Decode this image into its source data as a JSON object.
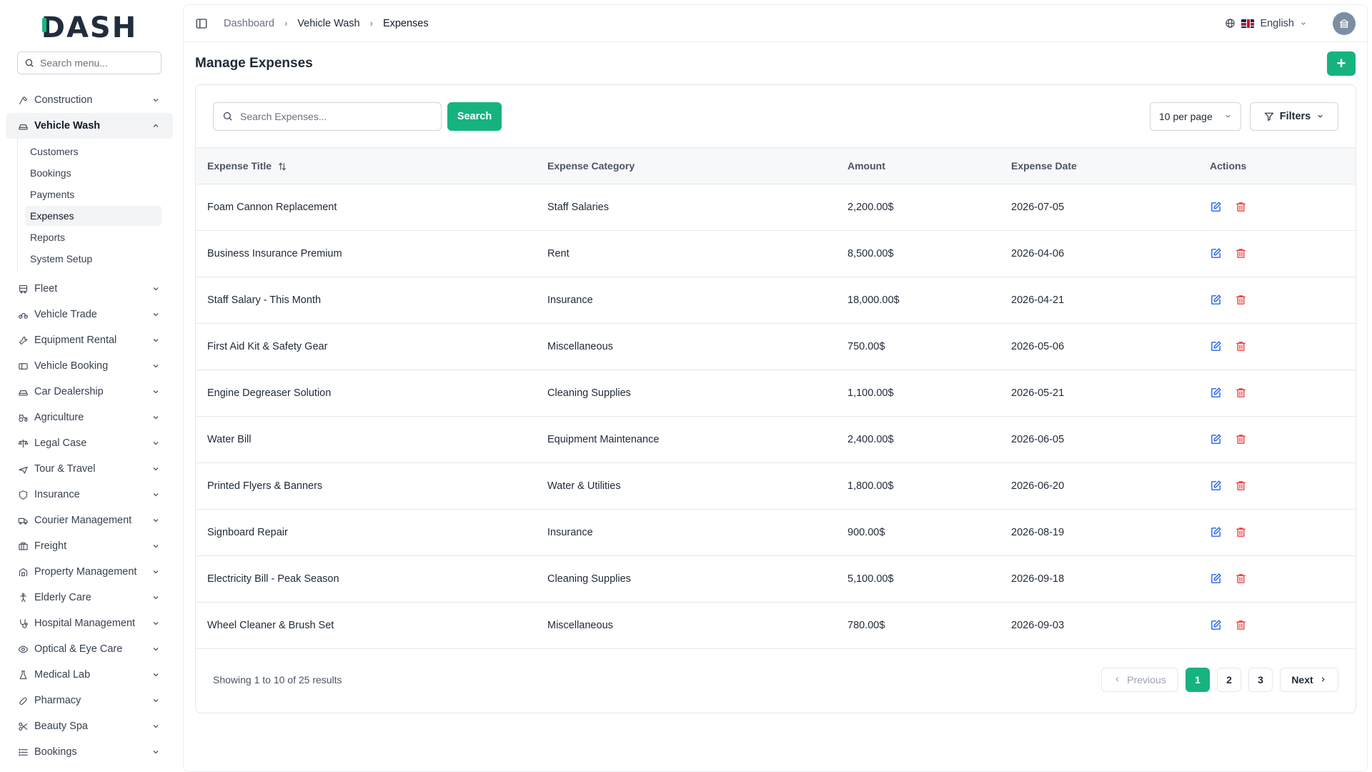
{
  "sidebar": {
    "logo": "DASH",
    "search_placeholder": "Search menu...",
    "items": [
      {
        "label": "Construction",
        "icon": "hammer-icon"
      },
      {
        "label": "Vehicle Wash",
        "icon": "car-icon",
        "expanded": true,
        "children": [
          {
            "label": "Customers"
          },
          {
            "label": "Bookings"
          },
          {
            "label": "Payments"
          },
          {
            "label": "Expenses",
            "active": true
          },
          {
            "label": "Reports"
          },
          {
            "label": "System Setup"
          }
        ]
      },
      {
        "label": "Fleet",
        "icon": "bus-icon"
      },
      {
        "label": "Vehicle Trade",
        "icon": "bike-icon"
      },
      {
        "label": "Equipment Rental",
        "icon": "wrench-icon"
      },
      {
        "label": "Vehicle Booking",
        "icon": "ticket-icon"
      },
      {
        "label": "Car Dealership",
        "icon": "car-icon"
      },
      {
        "label": "Agriculture",
        "icon": "tractor-icon"
      },
      {
        "label": "Legal Case",
        "icon": "scale-icon"
      },
      {
        "label": "Tour & Travel",
        "icon": "plane-icon"
      },
      {
        "label": "Insurance",
        "icon": "shield-icon"
      },
      {
        "label": "Courier Management",
        "icon": "truck-icon"
      },
      {
        "label": "Freight",
        "icon": "container-icon"
      },
      {
        "label": "Property Management",
        "icon": "building-icon"
      },
      {
        "label": "Elderly Care",
        "icon": "accessibility-icon"
      },
      {
        "label": "Hospital Management",
        "icon": "stethoscope-icon"
      },
      {
        "label": "Optical & Eye Care",
        "icon": "eye-icon"
      },
      {
        "label": "Medical Lab",
        "icon": "flask-icon"
      },
      {
        "label": "Pharmacy",
        "icon": "pill-icon"
      },
      {
        "label": "Beauty Spa",
        "icon": "scissors-icon"
      },
      {
        "label": "Bookings",
        "icon": "list-icon"
      }
    ]
  },
  "topbar": {
    "breadcrumb": [
      "Dashboard",
      "Vehicle Wash",
      "Expenses"
    ],
    "language": "English"
  },
  "page": {
    "title": "Manage Expenses",
    "add_label": "+"
  },
  "toolbar": {
    "search_placeholder": "Search Expenses...",
    "search_label": "Search",
    "per_page": "10 per page",
    "filters_label": "Filters"
  },
  "table": {
    "headers": [
      "Expense Title",
      "Expense Category",
      "Amount",
      "Expense Date",
      "Actions"
    ],
    "rows": [
      [
        "Foam Cannon Replacement",
        "Staff Salaries",
        "2,200.00$",
        "2026-07-05"
      ],
      [
        "Business Insurance Premium",
        "Rent",
        "8,500.00$",
        "2026-04-06"
      ],
      [
        "Staff Salary - This Month",
        "Insurance",
        "18,000.00$",
        "2026-04-21"
      ],
      [
        "First Aid Kit & Safety Gear",
        "Miscellaneous",
        "750.00$",
        "2026-05-06"
      ],
      [
        "Engine Degreaser Solution",
        "Cleaning Supplies",
        "1,100.00$",
        "2026-05-21"
      ],
      [
        "Water Bill",
        "Equipment Maintenance",
        "2,400.00$",
        "2026-06-05"
      ],
      [
        "Printed Flyers & Banners",
        "Water & Utilities",
        "1,800.00$",
        "2026-06-20"
      ],
      [
        "Signboard Repair",
        "Insurance",
        "900.00$",
        "2026-08-19"
      ],
      [
        "Electricity Bill - Peak Season",
        "Cleaning Supplies",
        "5,100.00$",
        "2026-09-18"
      ],
      [
        "Wheel Cleaner & Brush Set",
        "Miscellaneous",
        "780.00$",
        "2026-09-03"
      ]
    ]
  },
  "pagination": {
    "summary": "Showing 1 to 10 of 25 results",
    "previous": "Previous",
    "next": "Next",
    "pages": [
      "1",
      "2",
      "3"
    ],
    "current": "1"
  },
  "colors": {
    "accent": "#16b380",
    "edit": "#2563eb",
    "delete": "#ef4444"
  }
}
